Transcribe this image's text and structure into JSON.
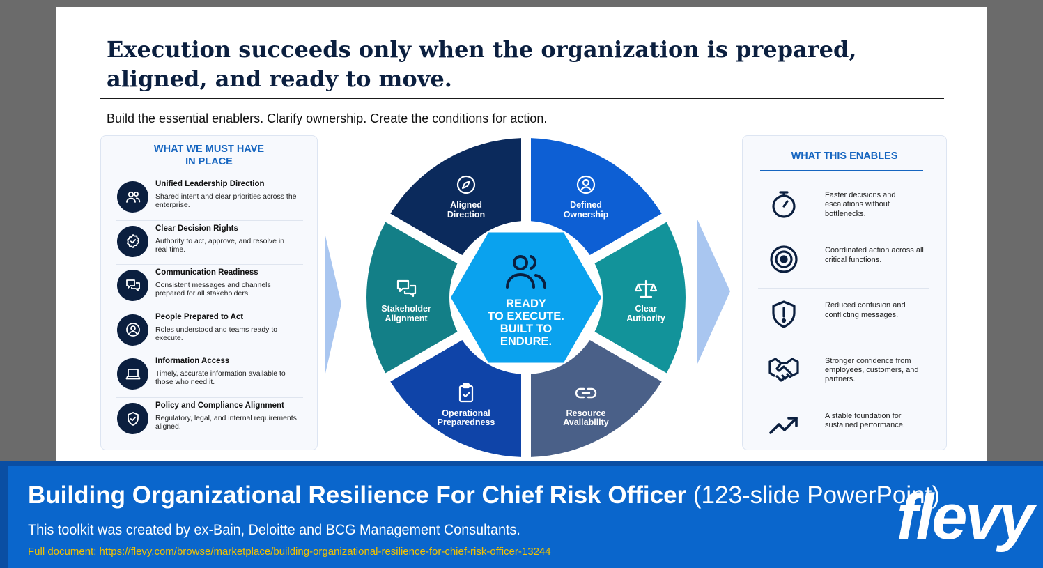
{
  "slide": {
    "title": "Execution succeeds only when the organization is prepared, aligned, and ready to move.",
    "subtitle": "Build the essential enablers.  Clarify ownership.  Create the conditions for action."
  },
  "left_panel": {
    "heading": "WHAT WE MUST HAVE\nIN PLACE",
    "items": [
      {
        "title": "Unified Leadership Direction",
        "desc": "Shared intent and clear priorities across the enterprise.",
        "icon": "people-icon"
      },
      {
        "title": "Clear Decision Rights",
        "desc": "Authority to act, approve, and resolve in real time.",
        "icon": "check-badge-icon"
      },
      {
        "title": "Communication Readiness",
        "desc": "Consistent messages and channels prepared for all stakeholders.",
        "icon": "chat-bubbles-icon"
      },
      {
        "title": "People Prepared to Act",
        "desc": "Roles understood and teams ready to execute.",
        "icon": "person-circle-icon"
      },
      {
        "title": "Information Access",
        "desc": "Timely, accurate information available to those who need it.",
        "icon": "laptop-icon"
      },
      {
        "title": "Policy and Compliance Alignment",
        "desc": "Regulatory, legal, and internal requirements aligned.",
        "icon": "shield-check-icon"
      }
    ]
  },
  "wheel": {
    "center_lines": [
      "READY",
      "TO EXECUTE.",
      "BUILT TO",
      "ENDURE."
    ],
    "segments": [
      {
        "lines": [
          "Aligned",
          "Direction"
        ],
        "icon": "compass-icon",
        "color": "#0b2a5c"
      },
      {
        "lines": [
          "Defined",
          "Ownership"
        ],
        "icon": "person-circle-icon",
        "color": "#0d5fd4"
      },
      {
        "lines": [
          "Clear",
          "Authority"
        ],
        "icon": "scales-icon",
        "color": "#12939a"
      },
      {
        "lines": [
          "Resource",
          "Availability"
        ],
        "icon": "link-icon",
        "color": "#4a6088"
      },
      {
        "lines": [
          "Operational",
          "Preparedness"
        ],
        "icon": "clipboard-check-icon",
        "color": "#0f44a8"
      },
      {
        "lines": [
          "Stakeholder",
          "Alignment"
        ],
        "icon": "chat-bubbles-icon",
        "color": "#137f87"
      }
    ],
    "center_color": "#0aa2ee"
  },
  "right_panel": {
    "heading": "WHAT THIS ENABLES",
    "items": [
      {
        "text": "Faster decisions and escalations without bottlenecks.",
        "icon": "stopwatch-icon"
      },
      {
        "text": "Coordinated action across all critical functions.",
        "icon": "target-icon"
      },
      {
        "text": "Reduced confusion and conflicting messages.",
        "icon": "shield-alert-icon"
      },
      {
        "text": "Stronger confidence from employees, customers, and partners.",
        "icon": "handshake-icon"
      },
      {
        "text": "A stable foundation for sustained performance.",
        "icon": "trend-up-icon"
      }
    ]
  },
  "banner": {
    "title_bold": "Building Organizational Resilience For Chief Risk Officer",
    "title_light": " (123-slide PowerPoint)",
    "subtitle": "This toolkit was created by ex-Bain, Deloitte and BCG Management Consultants.",
    "link": "Full document: https://flevy.com/browse/marketplace/building-organizational-resilience-for-chief-risk-officer-13244",
    "logo": "flevy"
  },
  "colors": {
    "navy": "#0b1f3f",
    "accent_blue": "#1565c0",
    "banner_blue": "#0a66cc",
    "link_yellow": "#f2c200",
    "arrow_light": "#a9c6f0"
  }
}
